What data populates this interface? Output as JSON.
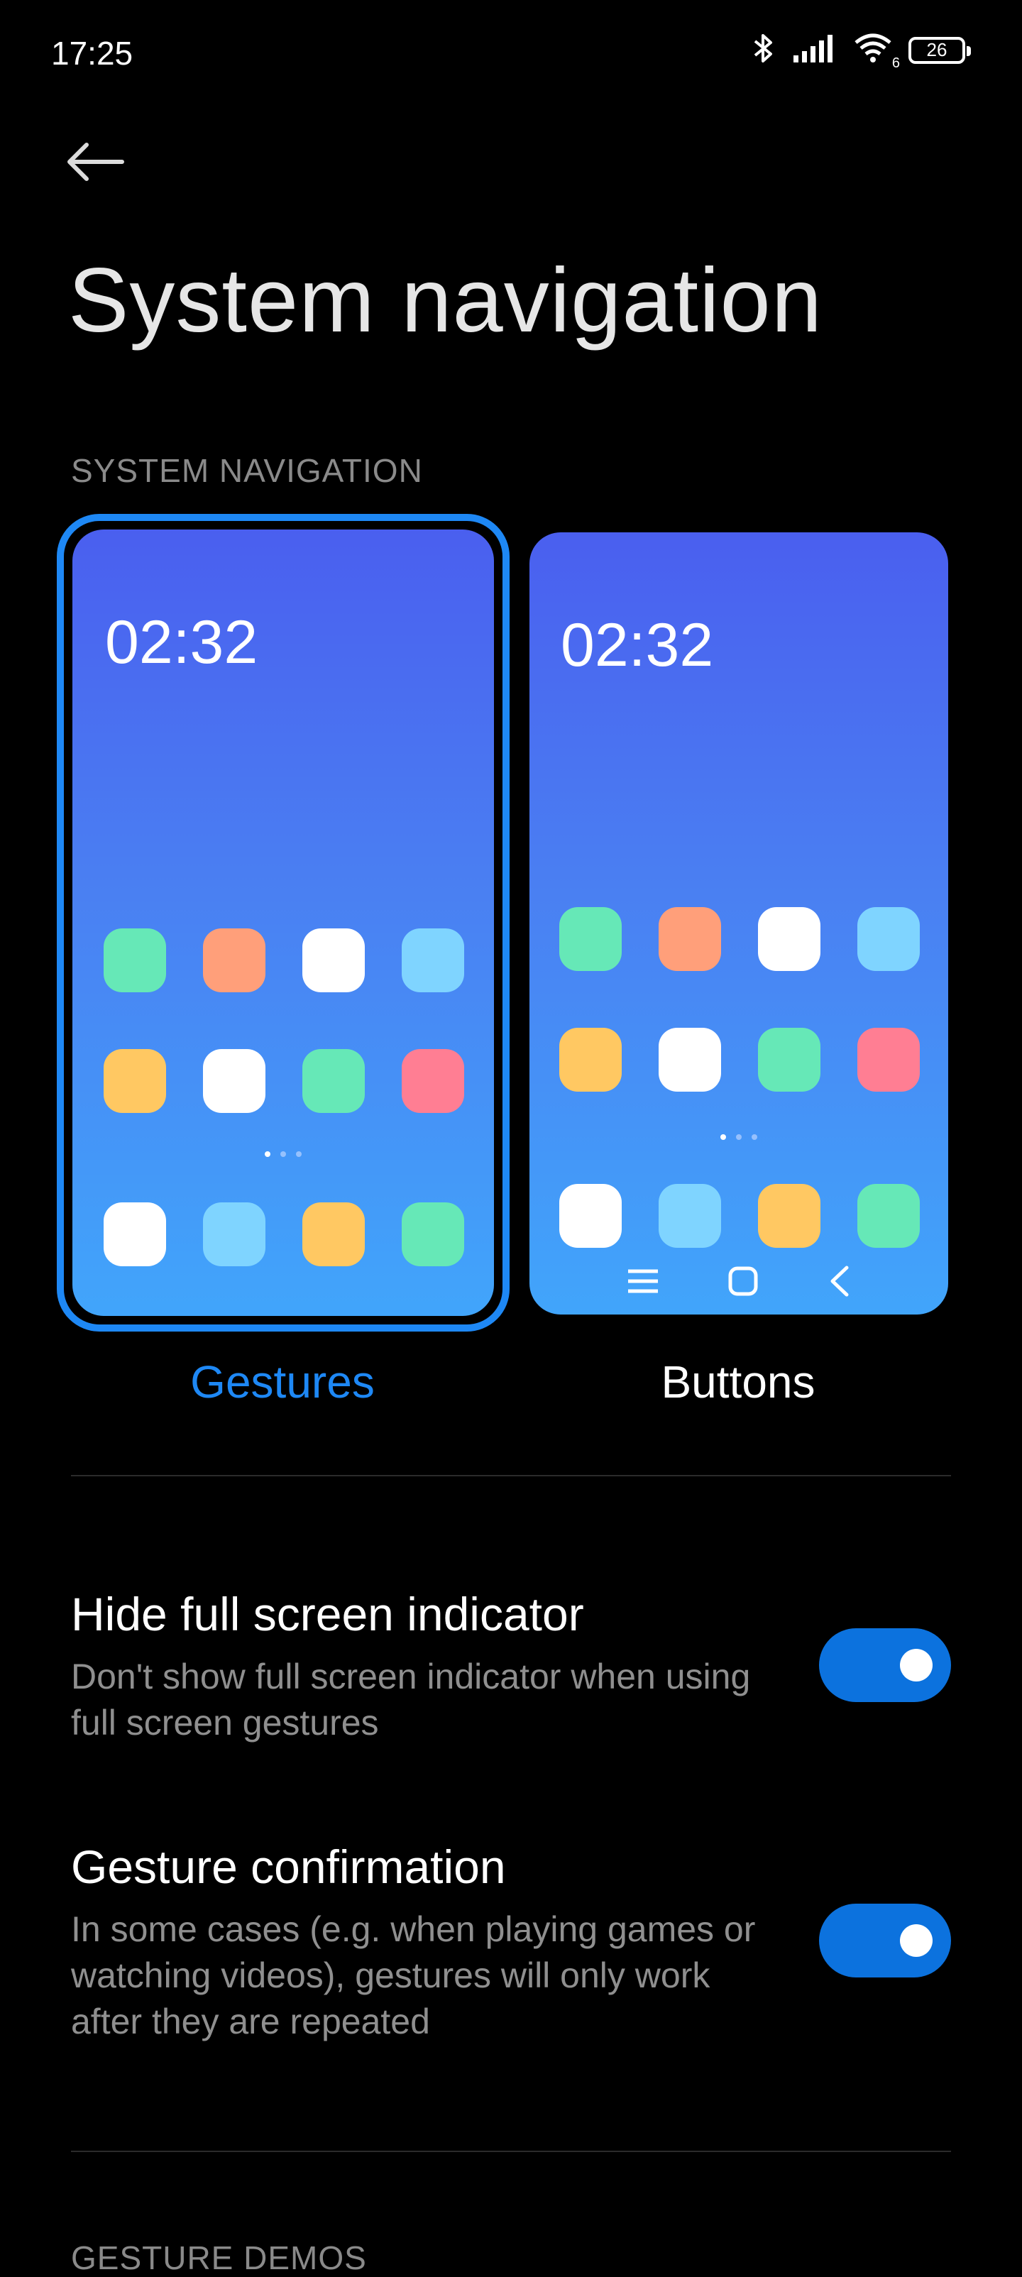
{
  "status_bar": {
    "time": "17:25",
    "battery_level": "26",
    "wifi_sub": "6"
  },
  "page": {
    "title": "System navigation"
  },
  "sections": {
    "system_navigation_header": "SYSTEM NAVIGATION",
    "gesture_demos_header": "GESTURE DEMOS"
  },
  "nav_modes": {
    "selected": "Gestures",
    "gestures": {
      "label": "Gestures",
      "preview_clock": "02:32"
    },
    "buttons": {
      "label": "Buttons",
      "preview_clock": "02:32"
    }
  },
  "settings": {
    "hide_indicator": {
      "title": "Hide full screen indicator",
      "description": "Don't show full screen indicator when using full screen gestures",
      "enabled": true
    },
    "gesture_confirmation": {
      "title": "Gesture confirmation",
      "description": "In some cases (e.g. when playing games or watching videos), gestures will only work after they are repeated",
      "enabled": true
    }
  },
  "colors": {
    "accent": "#1e88f5",
    "toggle_on": "#0c72de",
    "app_green": "#66e8b7",
    "app_orange": "#ff9f7a",
    "app_white": "#ffffff",
    "app_lightblue": "#7fd4ff",
    "app_yellow": "#ffc862",
    "app_pink": "#ff7e93"
  }
}
